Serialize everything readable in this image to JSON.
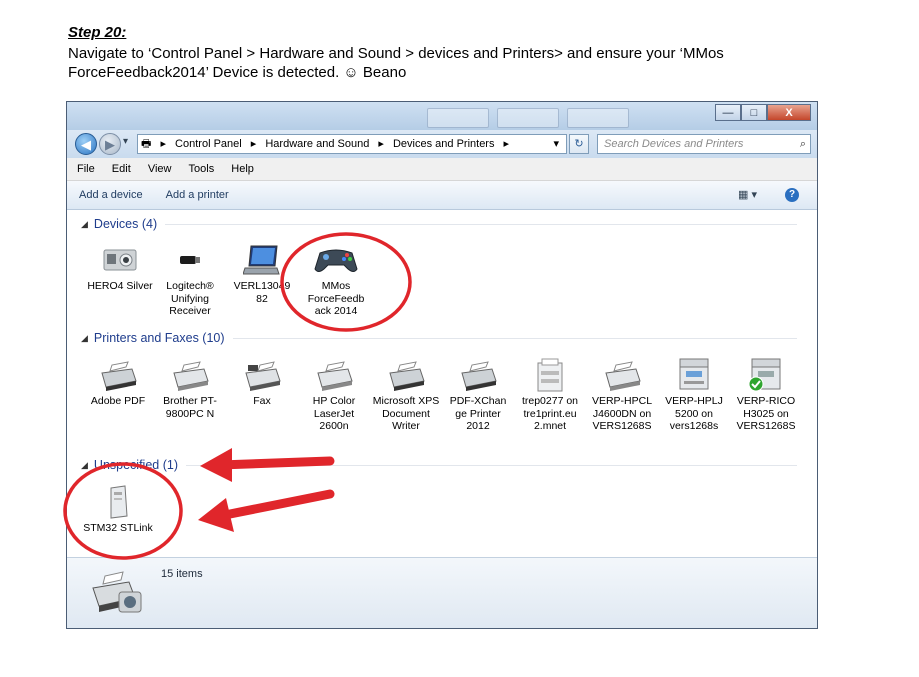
{
  "doc": {
    "step_title": "Step 20:",
    "instruction": "Navigate to ‘Control Panel > Hardware and Sound > devices and Printers> and ensure your ‘MMos ForceFeedback2014’ Device is detected. ☺ Beano"
  },
  "window": {
    "controls": {
      "minimize": "—",
      "maximize": "□",
      "close": "X"
    },
    "nav": {
      "back": "◀",
      "forward": "▶",
      "dropdown": "▾"
    },
    "breadcrumb": [
      "Control Panel",
      "Hardware and Sound",
      "Devices and Printers"
    ],
    "search_placeholder": "Search Devices and Printers",
    "menu": [
      "File",
      "Edit",
      "View",
      "Tools",
      "Help"
    ],
    "commands": [
      "Add a device",
      "Add a printer"
    ],
    "help": "?"
  },
  "groups": {
    "devices": {
      "label": "Devices (4)",
      "items": [
        {
          "label": "HERO4 Silver",
          "icon": "camera-icon"
        },
        {
          "label": "Logitech® Unifying Receiver",
          "icon": "usb-receiver-icon"
        },
        {
          "label": "VERL13049 82",
          "icon": "laptop-icon"
        },
        {
          "label": "MMos ForceFeedb ack 2014",
          "icon": "gamepad-icon"
        }
      ]
    },
    "printers": {
      "label": "Printers and Faxes (10)",
      "items": [
        {
          "label": "Adobe PDF",
          "icon": "printer-icon"
        },
        {
          "label": "Brother PT-9800PC N",
          "icon": "printer-icon"
        },
        {
          "label": "Fax",
          "icon": "fax-icon"
        },
        {
          "label": "HP Color LaserJet 2600n",
          "icon": "printer-icon"
        },
        {
          "label": "Microsoft XPS Document Writer",
          "icon": "printer-icon"
        },
        {
          "label": "PDF-XChan ge Printer 2012",
          "icon": "printer-icon"
        },
        {
          "label": "trep0277 on tre1print.eu 2.mnet",
          "icon": "network-printer-icon"
        },
        {
          "label": "VERP-HPCL J4600DN on VERS1268S",
          "icon": "printer-icon"
        },
        {
          "label": "VERP-HPLJ 5200 on vers1268s",
          "icon": "mfp-printer-icon"
        },
        {
          "label": "VERP-RICO H3025 on VERS1268S",
          "icon": "default-printer-icon"
        }
      ]
    },
    "unspecified": {
      "label": "Unspecified (1)",
      "items": [
        {
          "label": "STM32 STLink",
          "icon": "tower-device-icon"
        }
      ]
    }
  },
  "status": {
    "items_count": "15 items"
  },
  "colors": {
    "annotation_red": "#e0262b",
    "group_header": "#1e3c8c"
  }
}
